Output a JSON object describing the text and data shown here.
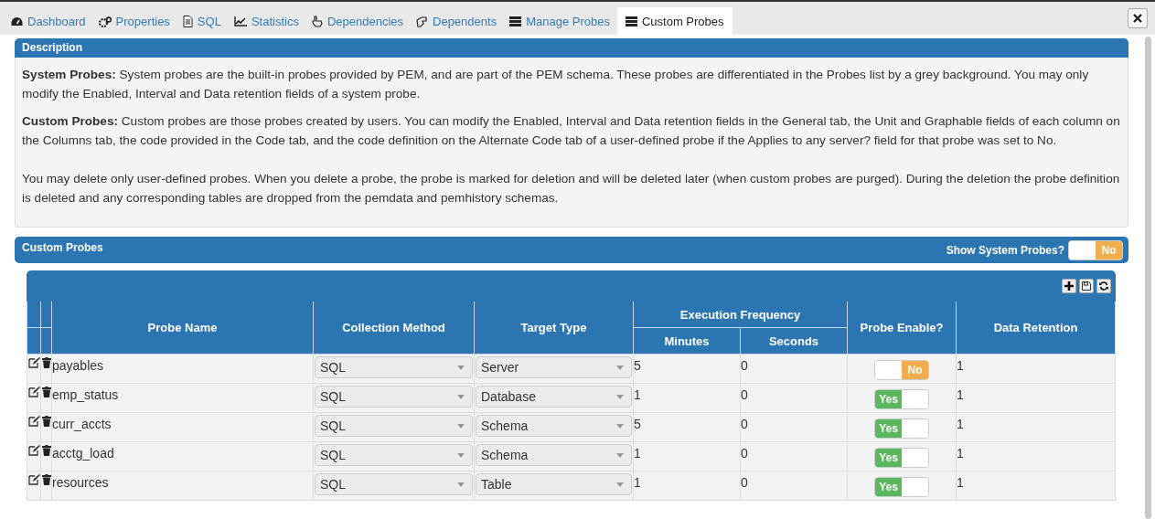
{
  "tabs": [
    {
      "label": "Dashboard",
      "selected": false
    },
    {
      "label": "Properties",
      "selected": false
    },
    {
      "label": "SQL",
      "selected": false
    },
    {
      "label": "Statistics",
      "selected": false
    },
    {
      "label": "Dependencies",
      "selected": false
    },
    {
      "label": "Dependents",
      "selected": false
    },
    {
      "label": "Manage Probes",
      "selected": false
    },
    {
      "label": "Custom Probes",
      "selected": true
    }
  ],
  "description": {
    "title": "Description",
    "paragraphs": [
      "**System Probes:** System probes are the built-in probes provided by PEM, and are part of the PEM schema. These probes are differentiated in the Probes list by a grey background. You may only modify the Enabled, Interval and Data retention fields of a system probe.",
      "**Custom Probes:** Custom probes are those probes created by users. You can modify the Enabled, Interval and Data retention fields in the General tab, the Unit and Graphable fields of each column on the Columns tab, the code provided in the Code tab, and the code definition on the Alternate Code tab of a user-defined probe if the Applies to any server? field for that probe was set to No.",
      "You may delete only user-defined probes. When you delete a probe, the probe is marked for deletion and will be deleted later (when custom probes are purged). During the deletion the probe definition is deleted and any corresponding tables are dropped from the pemdata and pemhistory schemas."
    ]
  },
  "custom_probes": {
    "title": "Custom Probes",
    "show_system_probes": {
      "label": "Show System Probes?",
      "on": false,
      "text": "No"
    },
    "table": {
      "columns": {
        "probe_name": "Probe Name",
        "collection_method": "Collection Method",
        "target_type": "Target Type",
        "execution_frequency": "Execution Frequency",
        "minutes": "Minutes",
        "seconds": "Seconds",
        "probe_enable": "Probe Enable?",
        "data_retention": "Data Retention"
      },
      "rows": [
        {
          "name": "payables",
          "collection_method": "SQL",
          "target_type": "Server",
          "minutes": "5",
          "seconds": "0",
          "enabled": {
            "on": false,
            "text": "No"
          },
          "data_retention": "1"
        },
        {
          "name": "emp_status",
          "collection_method": "SQL",
          "target_type": "Database",
          "minutes": "1",
          "seconds": "0",
          "enabled": {
            "on": true,
            "text": "Yes"
          },
          "data_retention": "1"
        },
        {
          "name": "curr_accts",
          "collection_method": "SQL",
          "target_type": "Schema",
          "minutes": "5",
          "seconds": "0",
          "enabled": {
            "on": true,
            "text": "Yes"
          },
          "data_retention": "1"
        },
        {
          "name": "acctg_load",
          "collection_method": "SQL",
          "target_type": "Schema",
          "minutes": "1",
          "seconds": "0",
          "enabled": {
            "on": true,
            "text": "Yes"
          },
          "data_retention": "1"
        },
        {
          "name": "resources",
          "collection_method": "SQL",
          "target_type": "Table",
          "minutes": "1",
          "seconds": "0",
          "enabled": {
            "on": true,
            "text": "Yes"
          },
          "data_retention": "1"
        }
      ]
    }
  }
}
